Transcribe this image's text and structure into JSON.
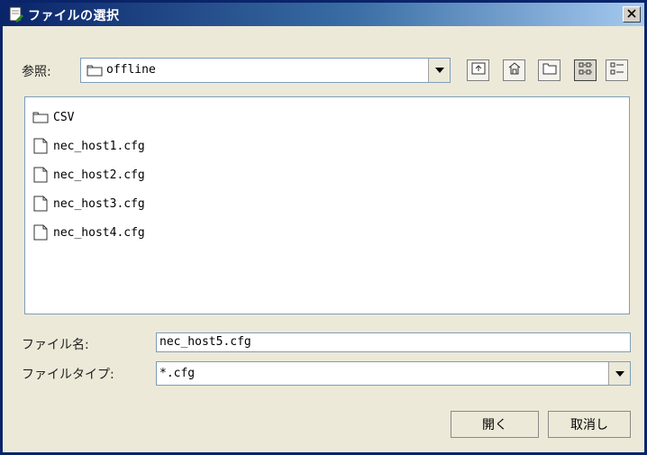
{
  "window": {
    "title": "ファイルの選択"
  },
  "lookin": {
    "label": "参照:",
    "value": "offline"
  },
  "toolbar": {
    "buttons": [
      "up-one-level",
      "home",
      "new-folder",
      "list-view",
      "details-view"
    ]
  },
  "files": [
    {
      "name": "CSV",
      "type": "folder"
    },
    {
      "name": "nec_host1.cfg",
      "type": "file"
    },
    {
      "name": "nec_host2.cfg",
      "type": "file"
    },
    {
      "name": "nec_host3.cfg",
      "type": "file"
    },
    {
      "name": "nec_host4.cfg",
      "type": "file"
    }
  ],
  "filename": {
    "label": "ファイル名:",
    "value": "nec_host5.cfg"
  },
  "filetype": {
    "label": "ファイルタイプ:",
    "value": "*.cfg"
  },
  "buttons": {
    "open": "開く",
    "cancel": "取消し"
  },
  "colors": {
    "title_start": "#0A246A",
    "title_end": "#A6CAF0",
    "background": "#ECE9D8"
  }
}
